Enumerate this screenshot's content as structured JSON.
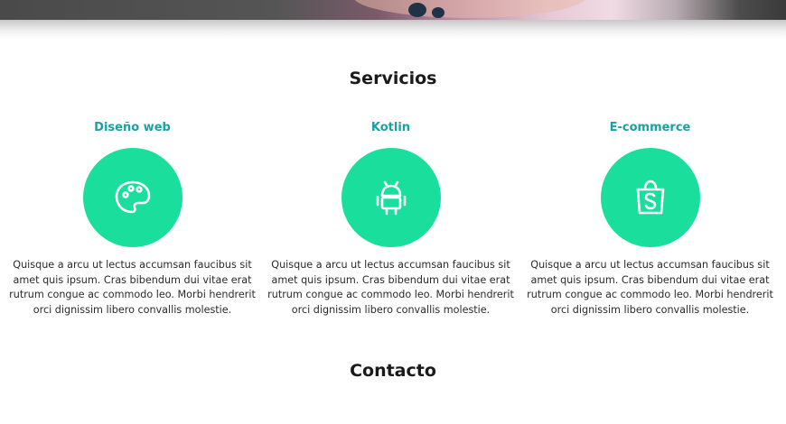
{
  "hero": {
    "image_icon": "photo-strip"
  },
  "services": {
    "title": "Servicios",
    "items": [
      {
        "title": "Diseño web",
        "icon": "palette-icon",
        "description": "Quisque a arcu ut lectus accumsan faucibus sit amet quis ipsum. Cras bibendum dui vitae erat rutrum congue ac commodo leo. Morbi hendrerit orci dignissim libero convallis molestie."
      },
      {
        "title": "Kotlin",
        "icon": "android-icon",
        "description": "Quisque a arcu ut lectus accumsan faucibus sit amet quis ipsum. Cras bibendum dui vitae erat rutrum congue ac commodo leo. Morbi hendrerit orci dignissim libero convallis molestie."
      },
      {
        "title": "E-commerce",
        "icon": "shopping-bag-icon",
        "description": "Quisque a arcu ut lectus accumsan faucibus sit amet quis ipsum. Cras bibendum dui vitae erat rutrum congue ac commodo leo. Morbi hendrerit orci dignissim libero convallis molestie."
      }
    ]
  },
  "contact": {
    "title": "Contacto"
  },
  "colors": {
    "accent_title": "#17a2a6",
    "circle": "#1adf9c",
    "text": "#2a2a2a"
  }
}
